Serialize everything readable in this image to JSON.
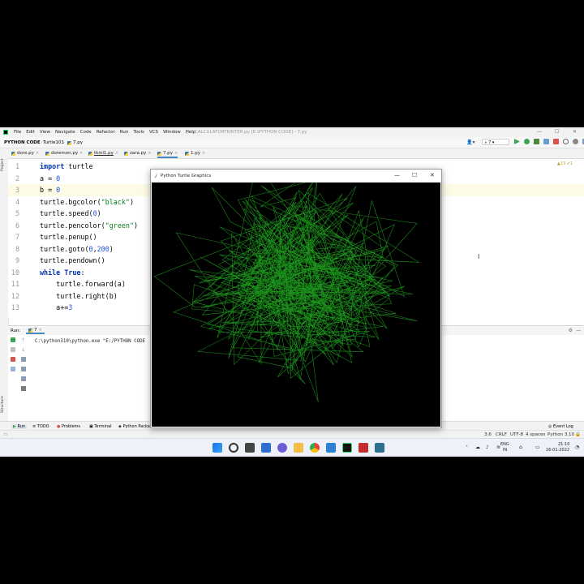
{
  "app": {
    "menu_items": [
      "File",
      "Edit",
      "View",
      "Navigate",
      "Code",
      "Refactor",
      "Run",
      "Tools",
      "VCS",
      "Window",
      "Help"
    ],
    "window_title": "CALCULATORTKINTER.py [E:\\PYTHON CODE] - 7.py"
  },
  "nav": {
    "project": "PYTHON CODE",
    "folder": "Turtle101",
    "file": "7.py",
    "run_config": "7"
  },
  "left_strip": {
    "project_label": "Project",
    "structure_label": "Structure",
    "favorites_label": "Favorites"
  },
  "tabs": [
    {
      "label": "dore.py"
    },
    {
      "label": "doremon.py"
    },
    {
      "label": "tkinl1.py"
    },
    {
      "label": "zara.py"
    },
    {
      "label": "7.py"
    },
    {
      "label": "1.py"
    }
  ],
  "editor": {
    "warnings": "▲13 ✔1",
    "lines": [
      {
        "n": "1",
        "code": "import turtle"
      },
      {
        "n": "2",
        "code": "a = 0"
      },
      {
        "n": "3",
        "code": "b = 0"
      },
      {
        "n": "4",
        "code": "turtle.bgcolor(\"black\")"
      },
      {
        "n": "5",
        "code": "turtle.speed(0)"
      },
      {
        "n": "6",
        "code": "turtle.pencolor(\"green\")"
      },
      {
        "n": "7",
        "code": "turtle.penup()"
      },
      {
        "n": "8",
        "code": "turtle.goto(0,200)"
      },
      {
        "n": "9",
        "code": "turtle.pendown()"
      },
      {
        "n": "10",
        "code": "while True:"
      },
      {
        "n": "11",
        "code": "    turtle.forward(a)"
      },
      {
        "n": "12",
        "code": "    turtle.right(b)"
      },
      {
        "n": "13",
        "code": "    a+=3"
      }
    ]
  },
  "run_panel": {
    "label": "Run:",
    "tab": "7",
    "console_line": "C:\\python310\\python.exe \"E:/PYTHON CODE"
  },
  "bottom_tabs": [
    "Run",
    "TODO",
    "Problems",
    "Terminal",
    "Python Packages",
    "Python Console"
  ],
  "event_log": "Event Log",
  "status": {
    "position": "3:6",
    "line_sep": "CRLF",
    "encoding": "UTF-8",
    "indent": "4 spaces",
    "interpreter": "Python 3.10"
  },
  "tray": {
    "lang": "ENG",
    "region": "IN",
    "time": "21:10",
    "date": "16-01-2022"
  },
  "turtle_window": {
    "title": "Python Turtle Graphics",
    "line_color": "#1fa21f",
    "bg": "#000000"
  },
  "colors": {
    "accent": "#4a88c7",
    "keyword": "#0033b3",
    "string": "#067d17",
    "number": "#1750eb"
  }
}
